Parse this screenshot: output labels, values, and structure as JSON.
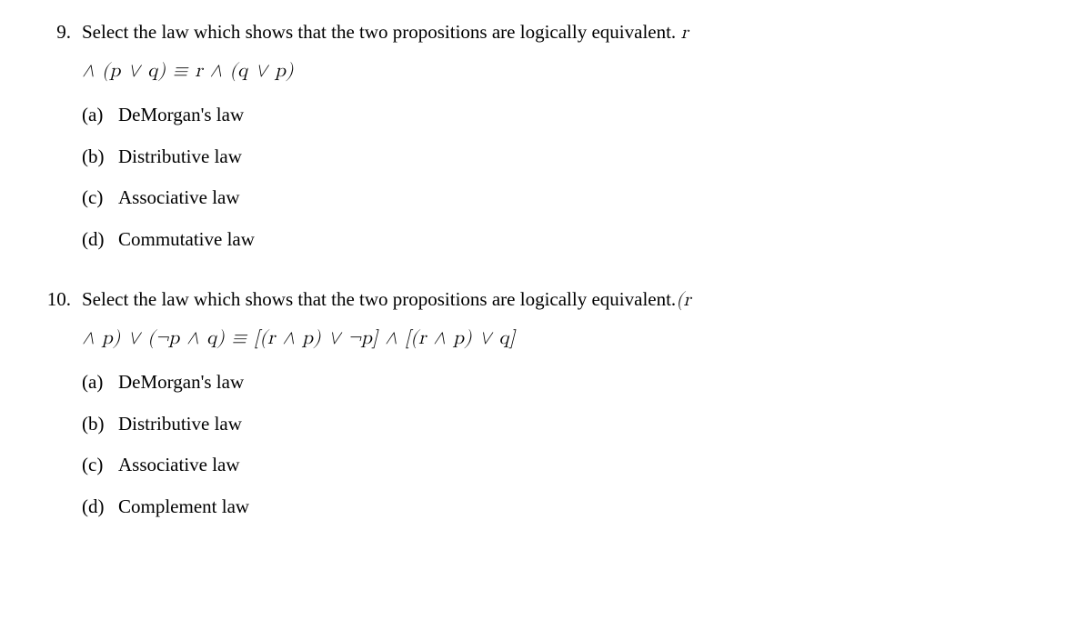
{
  "questions": [
    {
      "number": "9.",
      "prompt_prefix": "Select the law which shows that the two propositions are logically equivalent. ",
      "prompt_math_tail": "r",
      "formula": "∧ (p ∨ q) ≡ r ∧ (q ∨ p)",
      "options": [
        {
          "label": "(a)",
          "text": "DeMorgan's law"
        },
        {
          "label": "(b)",
          "text": "Distributive law"
        },
        {
          "label": "(c)",
          "text": "Associative law"
        },
        {
          "label": "(d)",
          "text": "Commutative law"
        }
      ]
    },
    {
      "number": "10.",
      "prompt_prefix": "Select the law which shows that the two propositions are logically equivalent.",
      "prompt_math_tail": "(r",
      "formula": "∧ p) ∨ (¬p ∧ q) ≡ [(r ∧ p) ∨ ¬p] ∧ [(r ∧ p) ∨ q]",
      "options": [
        {
          "label": "(a)",
          "text": "DeMorgan's law"
        },
        {
          "label": "(b)",
          "text": "Distributive law"
        },
        {
          "label": "(c)",
          "text": "Associative law"
        },
        {
          "label": "(d)",
          "text": "Complement law"
        }
      ]
    }
  ]
}
